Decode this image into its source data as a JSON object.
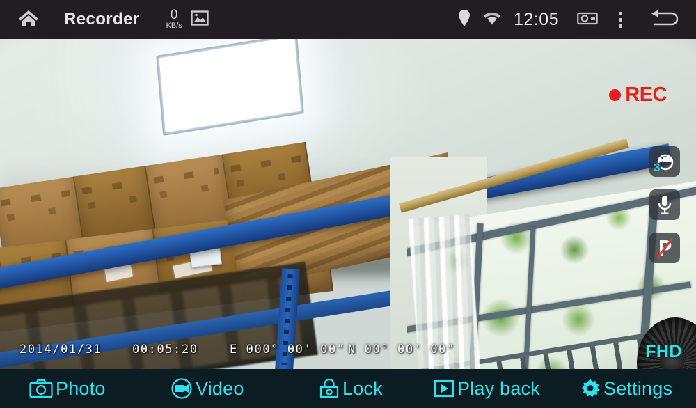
{
  "statusbar": {
    "home_icon": "home-icon",
    "title": "Recorder",
    "net_speed_value": "0",
    "net_speed_unit": "KB/s",
    "gallery_icon": "image-icon",
    "location_icon": "location-pin-icon",
    "wifi_icon": "wifi-icon",
    "clock": "12:05",
    "screenshot_icon": "camera-icon",
    "overflow_icon": "kebab-menu-icon",
    "back_icon": "back-arrow-icon",
    "bg_color": "#211d22",
    "text_color": "#e8e8e8"
  },
  "preview": {
    "rec_label": "REC",
    "rec_color": "#e8201b",
    "resolution_badge": "FHD",
    "resolution_color": "#22e8ef",
    "osd": {
      "date": "2014/01/31",
      "time": "00:05:20",
      "longitude": "E 000° 00' 00\"",
      "latitude": "N 00° 00' 00\""
    },
    "side_buttons": [
      {
        "name": "loop-recording-button",
        "icon": "loop-record-icon",
        "badge": "3"
      },
      {
        "name": "microphone-button",
        "icon": "microphone-icon",
        "badge": ""
      },
      {
        "name": "parking-monitor-button",
        "icon": "parking-disabled-icon",
        "badge": ""
      }
    ]
  },
  "bottombar": {
    "bg_color": "#0b1c22",
    "accent_color": "#2ae3ef",
    "items": [
      {
        "icon": "photo-camera-icon",
        "label": "Photo"
      },
      {
        "icon": "video-camera-icon",
        "label": "Video"
      },
      {
        "icon": "lock-icon",
        "label": "Lock"
      },
      {
        "icon": "play-icon",
        "label": "Play back"
      },
      {
        "icon": "gear-icon",
        "label": "Settings"
      }
    ]
  }
}
